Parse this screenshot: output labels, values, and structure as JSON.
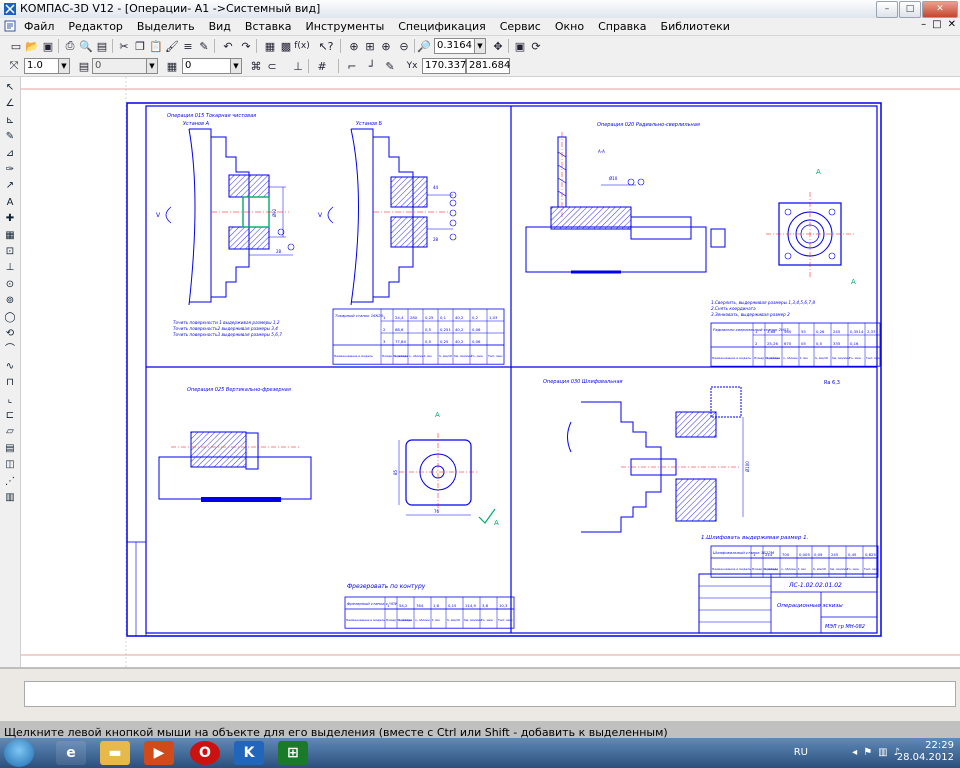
{
  "window": {
    "title": "КОМПАС-3D V12 - [Операции- A1 ->Системный вид]",
    "controls": {
      "minimize": "–",
      "maximize": "□",
      "close": "✕"
    }
  },
  "menu": {
    "items": [
      "Файл",
      "Редактор",
      "Выделить",
      "Вид",
      "Вставка",
      "Инструменты",
      "Спецификация",
      "Сервис",
      "Окно",
      "Справка",
      "Библиотеки"
    ],
    "doc_controls": [
      "–",
      "□",
      "✕"
    ]
  },
  "toolbar1": {
    "zoom_value": "0.3164"
  },
  "toolbar2": {
    "line_scale": "1.0",
    "layer_value": "0",
    "style_value": "0",
    "coord_x": "170.337",
    "coord_y": "281.684"
  },
  "drawing": {
    "colors": {
      "line": "#0000ee",
      "paper": "#ffffff",
      "hatch": "#0000ee",
      "center": "#ff0000",
      "green": "#00aa66"
    },
    "op1": {
      "heading": "Операция 015 Токарная чистовая",
      "setup_a": "Установ А",
      "setup_b": "Установ Б",
      "notes": [
        "Точить поверхности 1 выдерживая размеры 1,2",
        "Точить поверхность2 выдерживая размеры 3,4",
        "Точить поверхность3 выдерживая размеры 5,6,7"
      ],
      "machine": "Токарный станок 16К20",
      "table_rows": [
        [
          "1",
          "24,4",
          "280",
          "0,25",
          "0,1",
          "40,2",
          "0,2",
          "1,03"
        ],
        [
          "2",
          "68,6",
          "",
          "0,5",
          "0,251",
          "40,2",
          "0,06",
          ""
        ],
        [
          "3",
          "77,84",
          "",
          "0,5",
          "0,25",
          "40,2",
          "0,06",
          ""
        ]
      ],
      "table_header": [
        "Наименование и модель станка",
        "Номер перехода",
        "V, м/мин",
        "n, об/мин",
        "t, мм",
        "S, мм/об",
        "Sм, мм/мин",
        "Tо, мин",
        "Тшт, мин"
      ]
    },
    "op2": {
      "heading": "Операция 020 Радиально-сверлильная",
      "view": "А-А",
      "notes": [
        "1.Сверлить, выдерживая размеры 1,3,4,5,6,7,8",
        "2.Снять координата",
        "3.Зенковать, выдерживая размер 2"
      ],
      "machine": "Радиально-сверлильный станок 2Н53",
      "table_rows": [
        [
          "1",
          "3,68",
          "560",
          "55",
          "0,26",
          "245",
          "0,3514",
          "2,37"
        ],
        [
          "2",
          "25,26",
          "670",
          "05",
          "0,5",
          "335",
          "0,16",
          ""
        ]
      ]
    },
    "op3": {
      "heading": "Операция 025 Вертикально-фрезерная",
      "dims": [
        "85",
        "76"
      ],
      "note": "Фрезеровать по контуру",
      "machine": "Фрезерный станок с ЧПУ",
      "table_rows": [
        [
          "1",
          "54,2",
          "764",
          "1,6",
          "0,15",
          "114,9",
          "3,8",
          "10,3"
        ]
      ]
    },
    "op4": {
      "heading": "Операция 030 Шлифовальная",
      "roughness": "Ra 6,3",
      "note": "1.Шлифовать выдерживая размер 1.",
      "machine": "Шлифовальный станок 3Б12М",
      "table_rows": [
        [
          "1",
          "214",
          "700",
          "0,005",
          "0,09",
          "245",
          "0,45",
          "0,825"
        ]
      ]
    },
    "titleblock": {
      "code": "ЛС-1.02.02.01.02",
      "name": "Операционные эскизы",
      "org": "МЭЛ гр МН-082"
    },
    "section_label": "А"
  },
  "status": {
    "hint": "Щелкните левой кнопкой мыши на объекте для его выделения (вместе с Ctrl или Shift - добавить к выделенным)"
  },
  "taskbar": {
    "lang": "RU",
    "time": "22:29",
    "date": "28.04.2012"
  }
}
